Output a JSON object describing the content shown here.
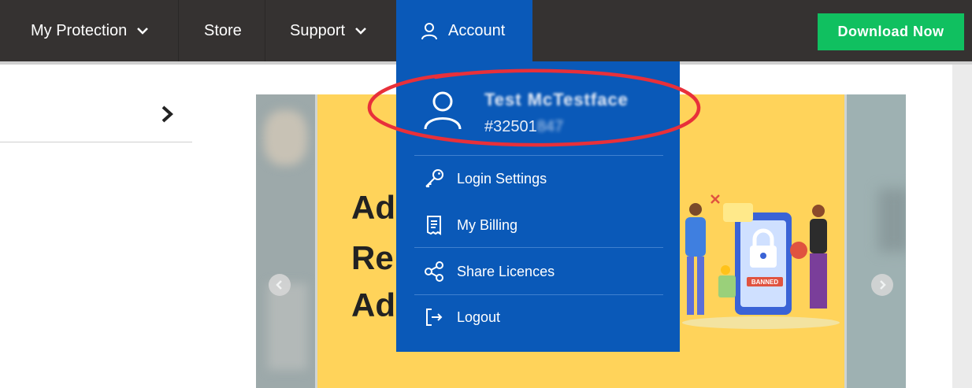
{
  "nav": {
    "items": [
      {
        "label": "My Protection",
        "has_chevron": true
      },
      {
        "label": "Store",
        "has_chevron": false
      },
      {
        "label": "Support",
        "has_chevron": true
      },
      {
        "label": "Account",
        "icon": "user-icon"
      }
    ],
    "download_label": "Download Now"
  },
  "colors": {
    "topbar": "#353231",
    "accent_blue": "#0a59b8",
    "download_green": "#10c060",
    "banner_yellow": "#ffd35a",
    "highlight_red": "#e8303a"
  },
  "account_menu": {
    "profile": {
      "name": "Test McTestface",
      "id_prefix": "#32501",
      "id_hidden": "847",
      "icon": "user-icon"
    },
    "items": [
      {
        "label": "Login Settings",
        "icon": "key-icon"
      },
      {
        "label": "My Billing",
        "icon": "receipt-icon"
      },
      {
        "label": "Share Licences",
        "icon": "share-icon"
      },
      {
        "label": "Logout",
        "icon": "logout-icon"
      }
    ]
  },
  "banner": {
    "headline_lines": [
      "Ad",
      "Re",
      "Ad"
    ],
    "badge_text": "BANNED"
  }
}
